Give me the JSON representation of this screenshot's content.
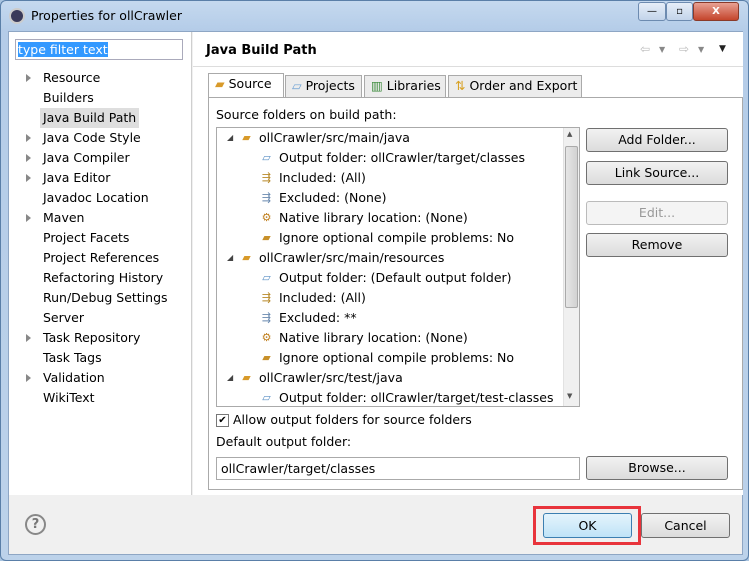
{
  "window": {
    "title": "Properties for ollCrawler",
    "minimize": "—",
    "maximize": "▫",
    "close": "X"
  },
  "filter": {
    "value": "type filter text"
  },
  "nav": [
    {
      "label": "Resource",
      "expandable": true
    },
    {
      "label": "Builders",
      "expandable": false
    },
    {
      "label": "Java Build Path",
      "expandable": false,
      "selected": true
    },
    {
      "label": "Java Code Style",
      "expandable": true
    },
    {
      "label": "Java Compiler",
      "expandable": true
    },
    {
      "label": "Java Editor",
      "expandable": true
    },
    {
      "label": "Javadoc Location",
      "expandable": false
    },
    {
      "label": "Maven",
      "expandable": true
    },
    {
      "label": "Project Facets",
      "expandable": false
    },
    {
      "label": "Project References",
      "expandable": false
    },
    {
      "label": "Refactoring History",
      "expandable": false
    },
    {
      "label": "Run/Debug Settings",
      "expandable": false
    },
    {
      "label": "Server",
      "expandable": false
    },
    {
      "label": "Task Repository",
      "expandable": true
    },
    {
      "label": "Task Tags",
      "expandable": false
    },
    {
      "label": "Validation",
      "expandable": true
    },
    {
      "label": "WikiText",
      "expandable": false
    }
  ],
  "page": {
    "title": "Java Build Path",
    "tabs": [
      {
        "label": "Source",
        "active": true
      },
      {
        "label": "Projects"
      },
      {
        "label": "Libraries"
      },
      {
        "label": "Order and Export"
      }
    ],
    "source_label": "Source folders on build path:",
    "tree": [
      {
        "level": 0,
        "label": "ollCrawler/src/main/java",
        "icon": "source-folder-icon"
      },
      {
        "level": 1,
        "label": "Output folder: ollCrawler/target/classes",
        "icon": "output-folder-icon"
      },
      {
        "level": 1,
        "label": "Included: (All)",
        "icon": "inclusion-filter-icon"
      },
      {
        "level": 1,
        "label": "Excluded: (None)",
        "icon": "exclusion-filter-icon"
      },
      {
        "level": 1,
        "label": "Native library location: (None)",
        "icon": "native-library-icon"
      },
      {
        "level": 1,
        "label": "Ignore optional compile problems: No",
        "icon": "ignore-problems-icon"
      },
      {
        "level": 0,
        "label": "ollCrawler/src/main/resources",
        "icon": "source-folder-icon"
      },
      {
        "level": 1,
        "label": "Output folder: (Default output folder)",
        "icon": "output-folder-icon"
      },
      {
        "level": 1,
        "label": "Included: (All)",
        "icon": "inclusion-filter-icon"
      },
      {
        "level": 1,
        "label": "Excluded: **",
        "icon": "exclusion-filter-icon"
      },
      {
        "level": 1,
        "label": "Native library location: (None)",
        "icon": "native-library-icon"
      },
      {
        "level": 1,
        "label": "Ignore optional compile problems: No",
        "icon": "ignore-problems-icon"
      },
      {
        "level": 0,
        "label": "ollCrawler/src/test/java",
        "icon": "source-folder-icon"
      },
      {
        "level": 1,
        "label": "Output folder: ollCrawler/target/test-classes",
        "icon": "output-folder-icon"
      }
    ],
    "buttons": {
      "add_folder": "Add Folder...",
      "link_source": "Link Source...",
      "edit": "Edit...",
      "remove": "Remove",
      "browse": "Browse..."
    },
    "allow_output": {
      "label": "Allow output folders for source folders",
      "checked": true
    },
    "default_output_label": "Default output folder:",
    "default_output_value": "ollCrawler/target/classes"
  },
  "footer": {
    "ok": "OK",
    "cancel": "Cancel",
    "help": "?"
  }
}
